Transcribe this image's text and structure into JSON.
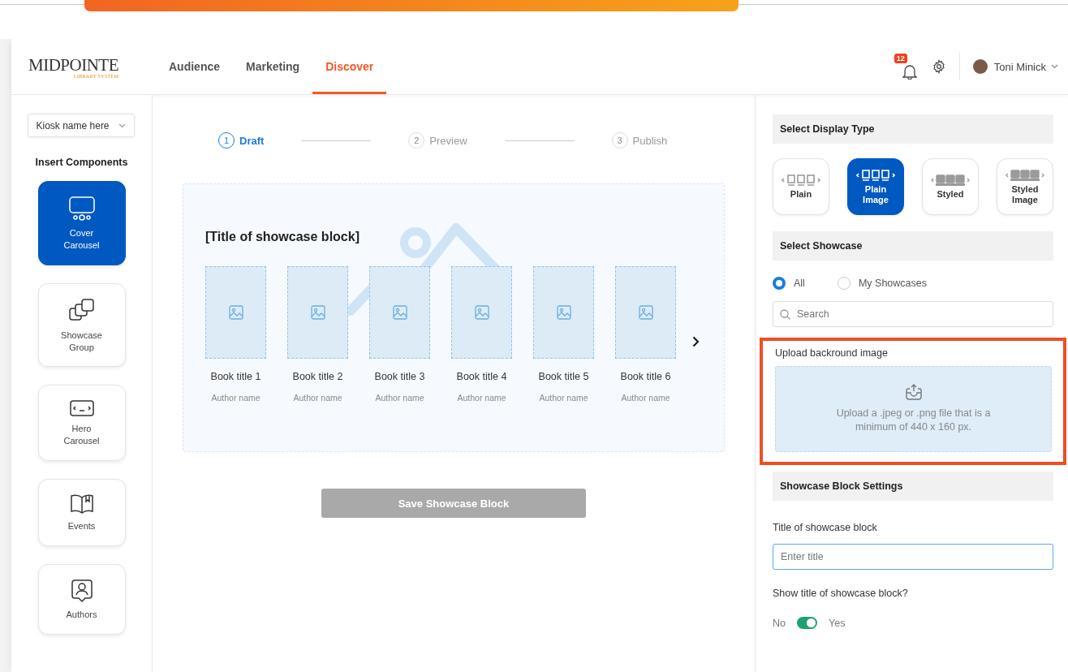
{
  "header": {
    "logo": {
      "name": "MIDPOINTE",
      "tagline": "LIBRARY SYSTEM"
    },
    "tabs": [
      {
        "label": "Audience",
        "selected": false
      },
      {
        "label": "Marketing",
        "selected": false
      },
      {
        "label": "Discover",
        "selected": true
      }
    ],
    "notifications": {
      "count": "12"
    },
    "user": {
      "name": "Toni Minick"
    }
  },
  "sidebar": {
    "kiosk_select": {
      "value": "Kiosk name here"
    },
    "heading": "Insert Components",
    "components": [
      {
        "label": "Cover Carousel",
        "kind": "carousel",
        "selected": true
      },
      {
        "label": "Showcase Group",
        "kind": "group",
        "selected": false
      },
      {
        "label": "Hero Carousel",
        "kind": "hero",
        "selected": false
      },
      {
        "label": "Events",
        "kind": "events",
        "selected": false
      },
      {
        "label": "Authors",
        "kind": "authors",
        "selected": false
      }
    ]
  },
  "stepper": {
    "steps": [
      {
        "number": "1",
        "label": "Draft",
        "selected": true
      },
      {
        "number": "2",
        "label": "Preview",
        "selected": false
      },
      {
        "number": "3",
        "label": "Publish",
        "selected": false
      }
    ]
  },
  "preview": {
    "title": "[Title of showcase block]",
    "books": [
      {
        "title": "Book title 1",
        "author": "Author name"
      },
      {
        "title": "Book title 2",
        "author": "Author name"
      },
      {
        "title": "Book title 3",
        "author": "Author name"
      },
      {
        "title": "Book title 4",
        "author": "Author name"
      },
      {
        "title": "Book title 5",
        "author": "Author name"
      },
      {
        "title": "Book title 6",
        "author": "Author name"
      }
    ]
  },
  "save_button": {
    "label": "Save Showcase Block",
    "disabled": true
  },
  "right_panel": {
    "display_type": {
      "heading": "Select Display Type",
      "options": [
        {
          "label": "Plain",
          "kind": "plain",
          "selected": false
        },
        {
          "label": "Plain Image",
          "kind": "plain",
          "selected": true
        },
        {
          "label": "Styled",
          "kind": "styled",
          "selected": false
        },
        {
          "label": "Styled Image",
          "kind": "styled",
          "selected": false
        }
      ]
    },
    "showcase": {
      "heading": "Select Showcase",
      "filters": [
        {
          "label": "All",
          "selected": true
        },
        {
          "label": "My Showcases",
          "selected": false
        }
      ],
      "search": {
        "placeholder": "Search"
      }
    },
    "upload": {
      "label": "Upload backround image",
      "hint": "Upload a .jpeg or .png file that is a minimum of 440 x 160 px.",
      "highlighted": true
    },
    "settings": {
      "heading": "Showcase Block Settings",
      "title_field": {
        "label": "Title of showcase block",
        "placeholder": "Enter title"
      },
      "show_title": {
        "question": "Show title of showcase block?",
        "off_label": "No",
        "on_label": "Yes",
        "on": true
      }
    }
  }
}
